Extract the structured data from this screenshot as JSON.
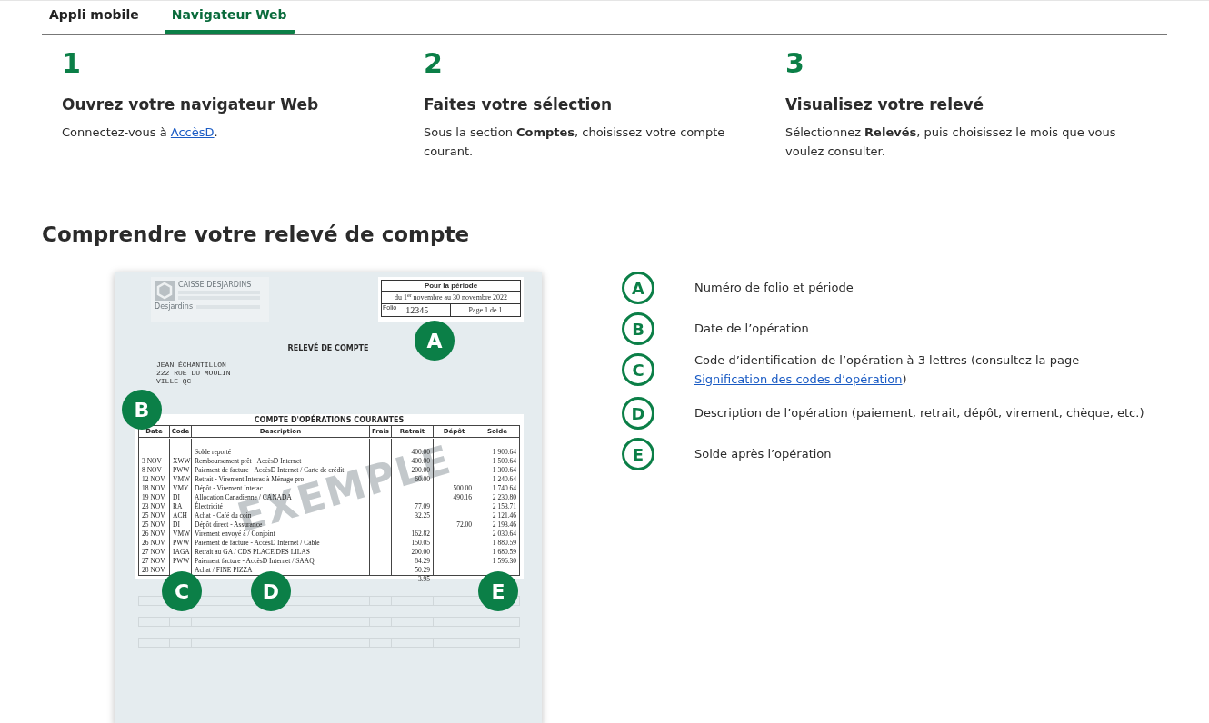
{
  "tabs": [
    {
      "label": "Appli mobile",
      "selected": false
    },
    {
      "label": "Navigateur Web",
      "selected": true
    }
  ],
  "steps": [
    {
      "number": "1",
      "title": "Ouvrez votre navigateur Web",
      "text": "Connectez-vous à ",
      "link": "AccèsD",
      "text_after": "."
    },
    {
      "number": "2",
      "title": "Faites votre sélection",
      "text": "Sous la section **Comptes**, choisissez votre compte courant."
    },
    {
      "number": "3",
      "title": "Visualisez votre relevé",
      "text": "Sélectionnez **Relevés**, puis choisissez le mois que vous voulez consulter."
    }
  ],
  "section_title": "Comprendre votre relevé de compte",
  "statement": {
    "bank_name": "CAISSE DESJARDINS",
    "logo_caption": "Desjardins",
    "period": {
      "header": "Pour la période",
      "range": "du 1$^{er}$ novembre au 30 novembre 2022",
      "folio_label": "Folio",
      "folio": "12345",
      "page": "Page 1 de 1"
    },
    "title": "RELEVÉ DE COMPTE",
    "address": [
      "JEAN ÉCHANTILLON",
      "222 RUE DU MOULIN",
      "VILLE QC"
    ],
    "table_title": "COMPTE D'OPÉRATIONS COURANTES",
    "columns": [
      "Date",
      "Code",
      "Description",
      "Frais",
      "Retrait",
      "Dépôt",
      "Solde"
    ],
    "rows": [
      [
        null,
        null,
        "Solde reporté",
        null,
        "400.00",
        null,
        "1 900.64"
      ],
      [
        "3 NOV",
        "XWW",
        "Remboursement prêt - AccèsD Internet",
        null,
        "400.00",
        null,
        "1 500.64"
      ],
      [
        "8 NOV",
        "PWW",
        "Paiement de facture - AccèsD Internet / Carte de crédit",
        null,
        "200.00",
        null,
        "1 300.64"
      ],
      [
        "12 NOV",
        "VMW",
        "Retrait - Virement Interac à Ménage pro",
        null,
        "60.00",
        null,
        "1 240.64"
      ],
      [
        "18 NOV",
        "VMY",
        "Dépôt - Virement Interac",
        null,
        null,
        "500.00",
        "1 740.64"
      ],
      [
        "19 NOV",
        "DI",
        "Allocation Canadienne / CANADA",
        null,
        null,
        "490.16",
        "2 230.80"
      ],
      [
        "23 NOV",
        "RA",
        "Électricité",
        null,
        "77.09",
        null,
        "2 153.71"
      ],
      [
        "25 NOV",
        "ACH",
        "Achat - Café du coin",
        null,
        "32.25",
        null,
        "2 121.46"
      ],
      [
        "25 NOV",
        "DI",
        "Dépôt direct - Assurance",
        null,
        null,
        "72.00",
        "2 193.46"
      ],
      [
        "26 NOV",
        "VMW",
        "Virement envoyé à / Conjoint",
        null,
        "162.82",
        null,
        "2 030.64"
      ],
      [
        "26 NOV",
        "PWW",
        "Paiement de facture - AccèsD Internet / Câble",
        null,
        "150.05",
        null,
        "1 880.59"
      ],
      [
        "27 NOV",
        "IAGA",
        "Retrait au GA / CDS PLACE DES LILAS",
        null,
        "200.00",
        null,
        "1 680.59"
      ],
      [
        "27 NOV",
        "PWW",
        "Paiement facture - AccèsD Internet / SAAQ",
        null,
        "84.29",
        null,
        "1 596.30"
      ],
      [
        "28 NOV",
        null,
        "Achat / FINE PIZZA",
        null,
        "50.29",
        null,
        null
      ],
      [
        null,
        null,
        null,
        null,
        "3.95",
        null,
        null
      ]
    ],
    "watermark": "EXEMPLE",
    "markers": [
      "A",
      "B",
      "C",
      "D",
      "E"
    ]
  },
  "legend": [
    {
      "letter": "A",
      "text": "Numéro de folio et période"
    },
    {
      "letter": "B",
      "text": "Date de l’opération"
    },
    {
      "letter": "C",
      "text": "Code d’identification de l’opération à 3 lettres (consultez la page ",
      "link": "Signification des codes d’opération",
      "text_after": ")"
    },
    {
      "letter": "D",
      "text": "Description de l’opération (paiement, retrait, dépôt, virement, chèque, etc.)"
    },
    {
      "letter": "E",
      "text": "Solde après l’opération"
    }
  ]
}
